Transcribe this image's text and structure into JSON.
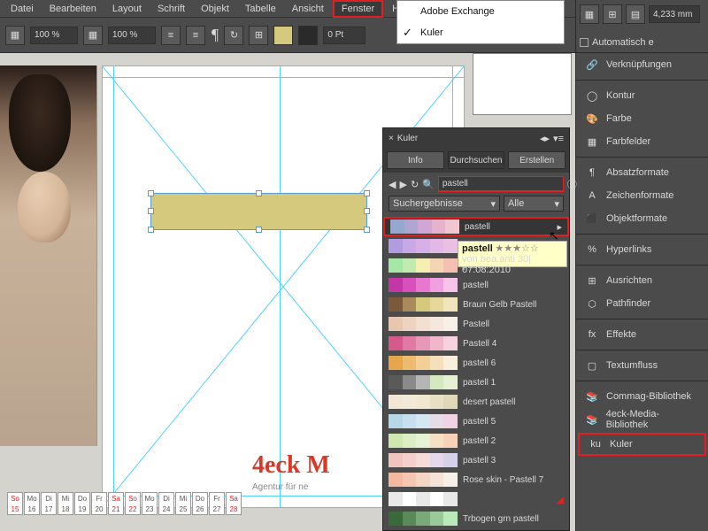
{
  "menu": [
    "Datei",
    "Bearbeiten",
    "Layout",
    "Schrift",
    "Objekt",
    "Tabelle",
    "Ansicht",
    "Fenster",
    "Hilfe"
  ],
  "dropdown": {
    "items": [
      "Adobe Exchange",
      "Kuler"
    ],
    "checked": 1
  },
  "toolbar": {
    "zoom": "100 %",
    "pt": "0 Pt",
    "mm": "4,233 mm",
    "auto": "Automatisch e"
  },
  "kuler": {
    "title": "Kuler",
    "tabs": [
      "Info",
      "Durchsuchen",
      "Erstellen"
    ],
    "search": "pastell",
    "filter1": "Suchergebnisse",
    "filter2": "Alle",
    "rows": [
      {
        "c": [
          "#95a8cf",
          "#b0a6d4",
          "#cfa6d4",
          "#e7b2cc",
          "#f0c6cf"
        ],
        "l": "pastell"
      },
      {
        "c": [
          "#b19ce0",
          "#c9a8e6",
          "#d6b0e6",
          "#e2b8e6",
          "#eac0e2"
        ],
        "l": "pastell"
      },
      {
        "c": [
          "#a6e6a6",
          "#c0ecb2",
          "#f5efb2",
          "#f5d6b2",
          "#f5c0b2"
        ],
        "l": "pastell"
      },
      {
        "c": [
          "#c236a8",
          "#d850bc",
          "#e877cf",
          "#f0a0de",
          "#f5c4e9"
        ],
        "l": "pastell"
      },
      {
        "c": [
          "#7a5a3a",
          "#a88b58",
          "#d4c97d",
          "#e6d89a",
          "#efe6bd"
        ],
        "l": "Braun Gelb Pastell"
      },
      {
        "c": [
          "#e8c6b0",
          "#eed4c0",
          "#f2dfcf",
          "#f5e7db",
          "#f8efe6"
        ],
        "l": "Pastell"
      },
      {
        "c": [
          "#d45a8c",
          "#e07aa4",
          "#e798b8",
          "#efb6cc",
          "#f4d2de"
        ],
        "l": "Pastell 4"
      },
      {
        "c": [
          "#e6a64c",
          "#ecbb70",
          "#f1cf96",
          "#f5e0bb",
          "#f9efdd"
        ],
        "l": "pastell 6"
      },
      {
        "c": [
          "#5a5a5a",
          "#8a8a8a",
          "#b5b5b5",
          "#d6e8c0",
          "#e6f0d4"
        ],
        "l": "pastell 1"
      },
      {
        "c": [
          "#f2e7d5",
          "#f2ead8",
          "#f0e8d0",
          "#e8e0c4",
          "#e0d8b8"
        ],
        "l": "desert pastell"
      },
      {
        "c": [
          "#b7d6e8",
          "#c7dfee",
          "#d5e8f2",
          "#e5dce8",
          "#f0d2e4"
        ],
        "l": "pastell 5"
      },
      {
        "c": [
          "#cfe8b0",
          "#dcefc4",
          "#e6f2d4",
          "#f5e0c4",
          "#f8d2b8"
        ],
        "l": "pastell 2"
      },
      {
        "c": [
          "#f2c4c0",
          "#f4d0cc",
          "#f6dcd8",
          "#e4d8ec",
          "#d4d0e8"
        ],
        "l": "pastell 3"
      },
      {
        "c": [
          "#f5b9a0",
          "#f5c7b2",
          "#f5d5c4",
          "#f5e3d6",
          "#f5f1e8"
        ],
        "l": "Rose skin - Pastell 7"
      },
      {
        "c": [
          "#e8e8e8",
          "#ffffff",
          "#e8e8e8",
          "#ffffff",
          "#e8e8e8"
        ],
        "l": ""
      },
      {
        "c": [
          "#3a6a3a",
          "#5a8a5a",
          "#7aaa7a",
          "#9aca9a",
          "#baeaba"
        ],
        "l": "Trbogen grn pastell"
      }
    ],
    "tip_title": "pastell",
    "tip_sub": "von bea.anti  30| 07.08.2010"
  },
  "right": [
    "Verknüpfungen",
    "Kontur",
    "Farbe",
    "Farbfelder",
    "Absatzformate",
    "Zeichenformate",
    "Objektformate",
    "Hyperlinks",
    "Ausrichten",
    "Pathfinder",
    "Effekte",
    "Textumfluss",
    "Commag-Bibliothek",
    "4eck-Media-Bibliothek",
    "Kuler"
  ],
  "brand": "4eck M",
  "sub": "Agentur für ne",
  "cal": [
    [
      "So",
      "15"
    ],
    [
      "Mo",
      "16"
    ],
    [
      "Di",
      "17"
    ],
    [
      "Mi",
      "18"
    ],
    [
      "Do",
      "19"
    ],
    [
      "Fr",
      "20"
    ],
    [
      "Sa",
      "21"
    ],
    [
      "So",
      "22"
    ],
    [
      "Mo",
      "23"
    ],
    [
      "Di",
      "24"
    ],
    [
      "Mi",
      "25"
    ],
    [
      "Do",
      "26"
    ],
    [
      "Fr",
      "27"
    ],
    [
      "Sa",
      "28"
    ]
  ]
}
